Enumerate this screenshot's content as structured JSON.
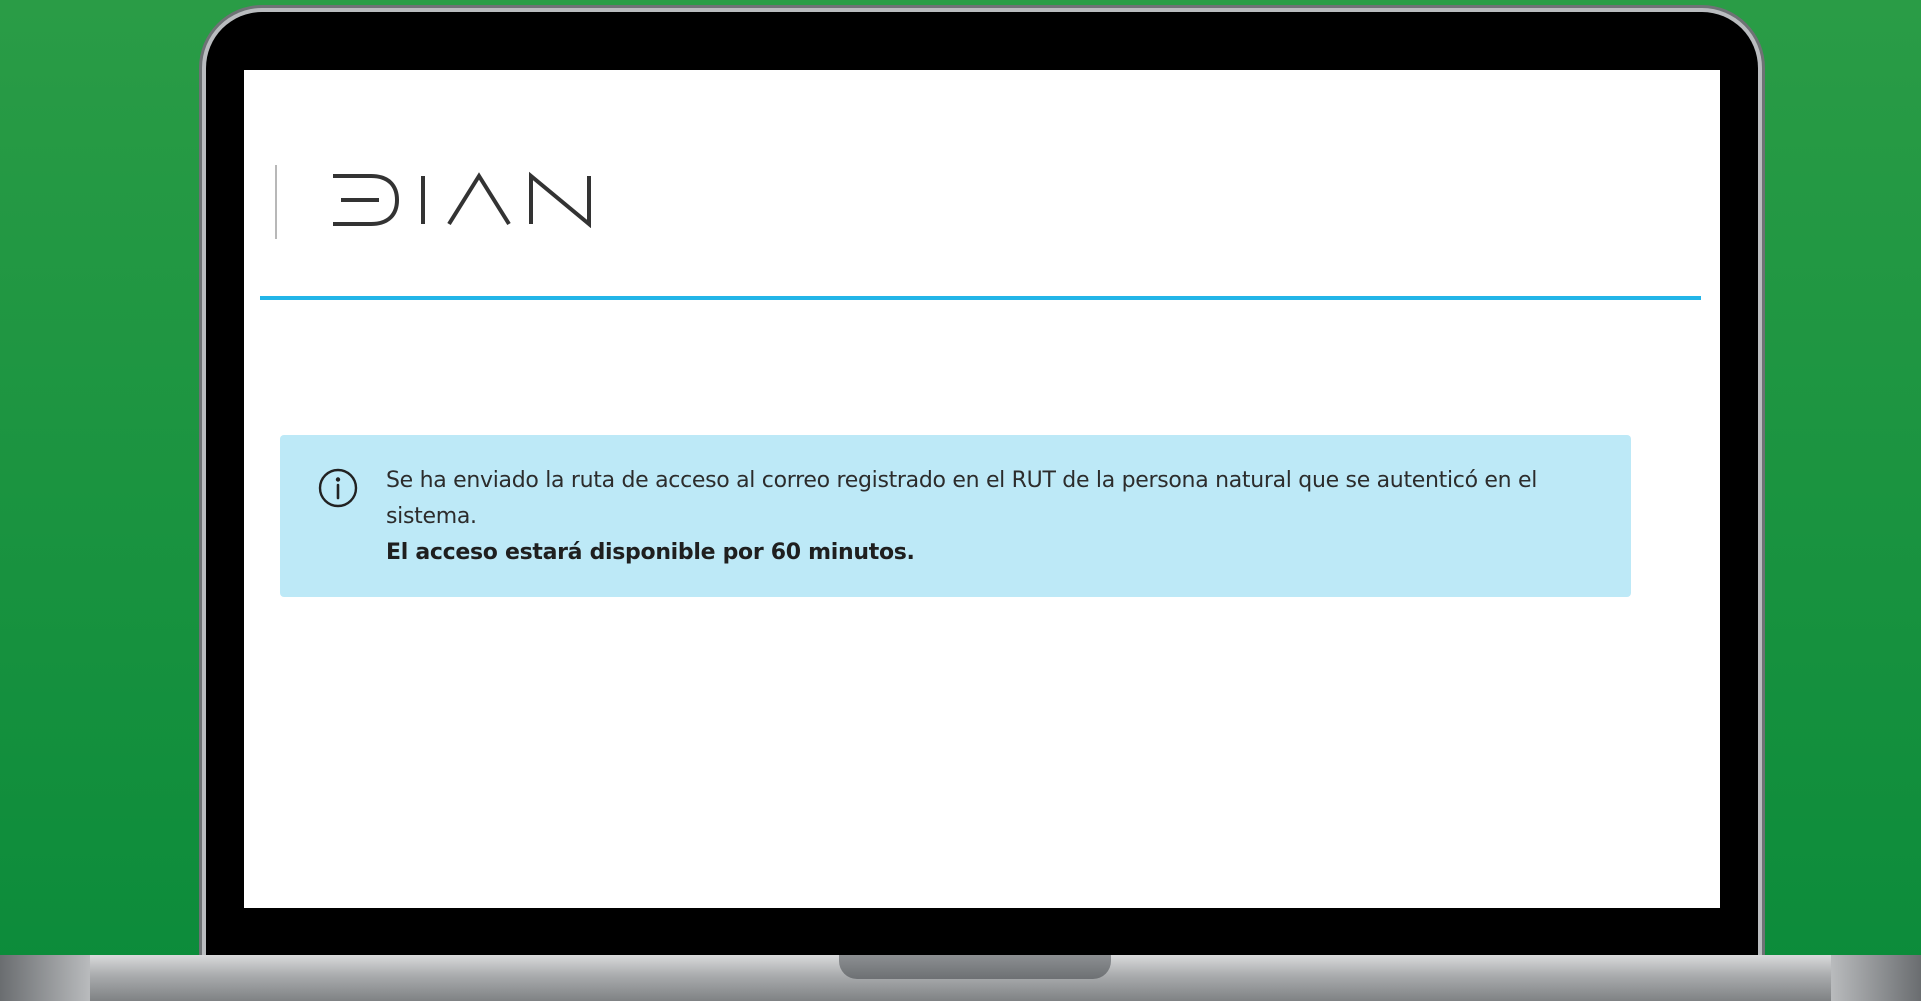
{
  "header": {
    "logo_text": "DIAN",
    "accent_color": "#22b5e8"
  },
  "alert": {
    "icon": "info-icon",
    "message": "Se ha enviado la ruta de acceso al correo registrado en el RUT de la persona natural que se autenticó en el sistema.",
    "emphasis": "El acceso estará disponible por 60 minutos.",
    "background_color": "#bde9f7"
  }
}
